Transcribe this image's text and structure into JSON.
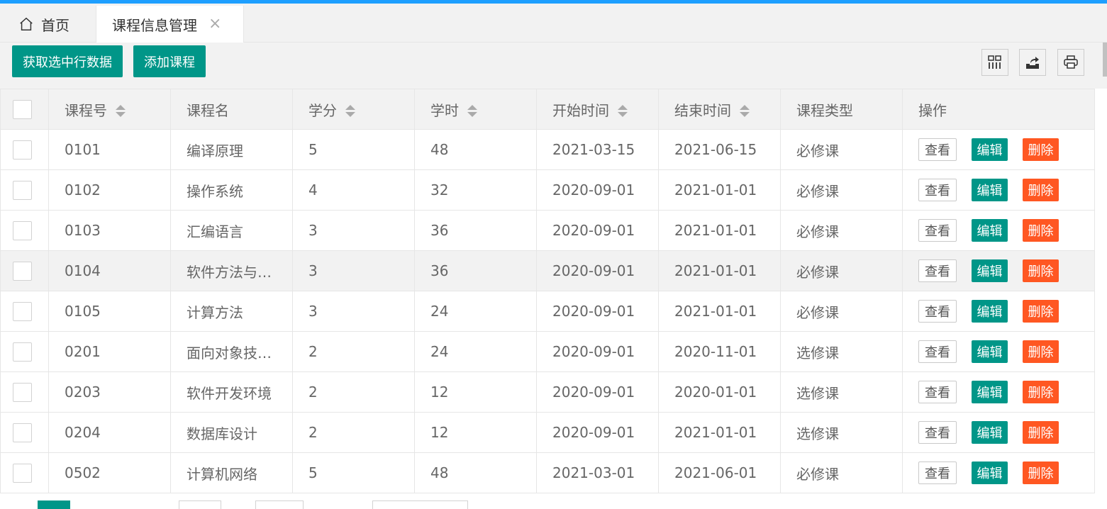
{
  "tabs": {
    "home_label": "首页",
    "active_label": "课程信息管理",
    "close_symbol": "×"
  },
  "toolbar": {
    "get_rows_label": "获取选中行数据",
    "add_course_label": "添加课程",
    "icons": [
      "columns-icon",
      "export-icon",
      "print-icon"
    ]
  },
  "table": {
    "headers": [
      "课程号",
      "课程名",
      "学分",
      "学时",
      "开始时间",
      "结束时间",
      "课程类型",
      "操作"
    ],
    "rows": [
      {
        "id": "0101",
        "name": "编译原理",
        "credit": "5",
        "hours": "48",
        "start": "2021-03-15",
        "end": "2021-06-15",
        "type": "必修课"
      },
      {
        "id": "0102",
        "name": "操作系统",
        "credit": "4",
        "hours": "32",
        "start": "2020-09-01",
        "end": "2021-01-01",
        "type": "必修课"
      },
      {
        "id": "0103",
        "name": "汇编语言",
        "credit": "3",
        "hours": "36",
        "start": "2020-09-01",
        "end": "2021-01-01",
        "type": "必修课"
      },
      {
        "id": "0104",
        "name": "软件方法与…",
        "credit": "3",
        "hours": "36",
        "start": "2020-09-01",
        "end": "2021-01-01",
        "type": "必修课"
      },
      {
        "id": "0105",
        "name": "计算方法",
        "credit": "3",
        "hours": "24",
        "start": "2020-09-01",
        "end": "2021-01-01",
        "type": "必修课"
      },
      {
        "id": "0201",
        "name": "面向对象技…",
        "credit": "2",
        "hours": "24",
        "start": "2020-09-01",
        "end": "2020-11-01",
        "type": "选修课"
      },
      {
        "id": "0203",
        "name": "软件开发环境",
        "credit": "2",
        "hours": "12",
        "start": "2020-09-01",
        "end": "2020-01-01",
        "type": "选修课"
      },
      {
        "id": "0204",
        "name": "数据库设计",
        "credit": "2",
        "hours": "12",
        "start": "2020-09-01",
        "end": "2021-01-01",
        "type": "选修课"
      },
      {
        "id": "0502",
        "name": "计算机网络",
        "credit": "5",
        "hours": "48",
        "start": "2021-03-01",
        "end": "2021-06-01",
        "type": "必修课"
      }
    ],
    "actions": {
      "view": "查看",
      "edit": "编辑",
      "delete": "删除"
    }
  },
  "colors": {
    "accent": "#009688",
    "danger": "#FF5722",
    "topbar": "#1E9FFF"
  }
}
